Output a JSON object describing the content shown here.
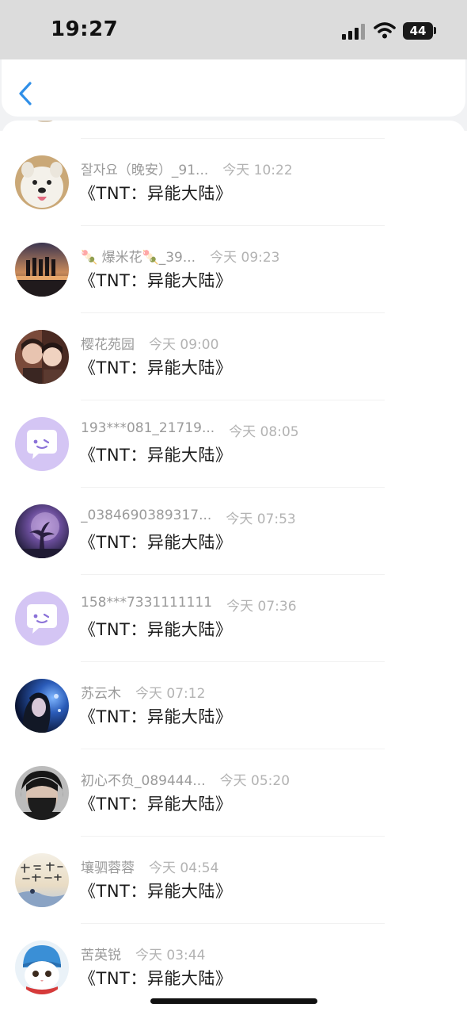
{
  "status_bar": {
    "time": "19:27",
    "battery_level": "44",
    "icons": [
      "cellular-signal-icon",
      "wifi-icon",
      "battery-icon"
    ]
  },
  "header": {
    "back_icon": "chevron-left-icon",
    "accent_color": "#2f8fe8"
  },
  "messages": [
    {
      "username": "잘자요（晚安）_91...",
      "time": "今天 10:22",
      "text": "《TNT：异能大陆》",
      "avatar": "white-samoyed-dog"
    },
    {
      "username": "🍡 爆米花🍡_39...",
      "time": "今天 09:23",
      "text": "《TNT：异能大陆》",
      "avatar": "group-silhouette-sunset"
    },
    {
      "username": "樱花苑园",
      "time": "今天 09:00",
      "text": "《TNT：异能大陆》",
      "avatar": "two-people-portrait"
    },
    {
      "username": "193***081_21719...",
      "time": "今天 08:05",
      "text": "《TNT：异能大陆》",
      "avatar": "default-chat-bubble"
    },
    {
      "username": "_0384690389317...",
      "time": "今天 07:53",
      "text": "《TNT：异能大陆》",
      "avatar": "purple-moon-night"
    },
    {
      "username": "158***7331111111",
      "time": "今天 07:36",
      "text": "《TNT：异能大陆》",
      "avatar": "default-chat-bubble"
    },
    {
      "username": "苏云木",
      "time": "今天 07:12",
      "text": "《TNT：异能大陆》",
      "avatar": "girl-blue-night"
    },
    {
      "username": "初心不负_089444...",
      "time": "今天 05:20",
      "text": "《TNT：异能大陆》",
      "avatar": "masked-person"
    },
    {
      "username": "壤驷蓉蓉",
      "time": "今天 04:54",
      "text": "《TNT：异能大陆》",
      "avatar": "calligraphy-art"
    },
    {
      "username": "苦英锐",
      "time": "今天 03:44",
      "text": "《TNT：异能大陆》",
      "avatar": "cat-in-knit-hat"
    }
  ]
}
